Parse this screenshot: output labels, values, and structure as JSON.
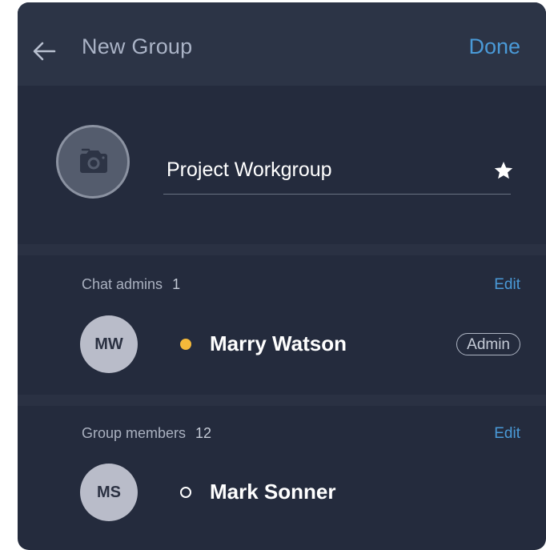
{
  "header": {
    "title": "New Group",
    "done_label": "Done"
  },
  "group": {
    "name": "Project Workgroup"
  },
  "admins_section": {
    "label": "Chat admins",
    "count": "1",
    "edit_label": "Edit",
    "members": [
      {
        "initials": "MW",
        "name": "Marry Watson",
        "status": "online",
        "badge": "Admin"
      }
    ]
  },
  "members_section": {
    "label": "Group members",
    "count": "12",
    "edit_label": "Edit",
    "members": [
      {
        "initials": "MS",
        "name": "Mark Sonner",
        "status": "offline"
      }
    ]
  },
  "colors": {
    "background": "#242b3d",
    "header": "#2c3446",
    "accent": "#4a9ad8",
    "online_status": "#f5b93a"
  },
  "icons": {
    "back": "arrow-left-icon",
    "camera": "camera-icon",
    "star": "star-icon"
  }
}
